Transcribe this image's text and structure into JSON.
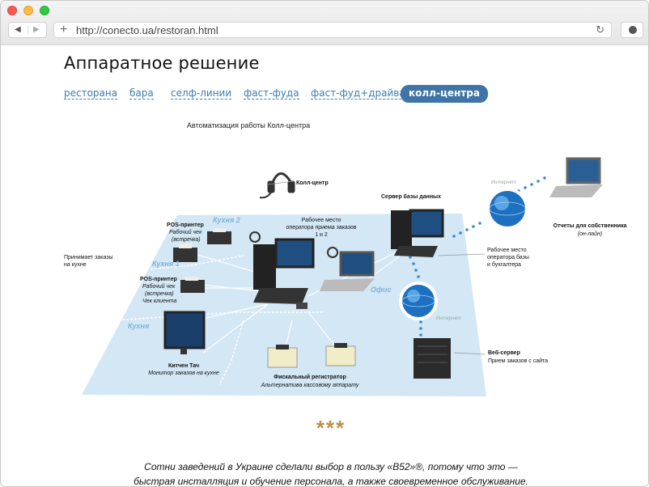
{
  "browser": {
    "url": "http://conecto.ua/restoran.html",
    "back": "◀",
    "forward": "▶",
    "new_tab": "+",
    "reload": "↻"
  },
  "page": {
    "title": "Аппаратное решение",
    "tabs": [
      {
        "label": "ресторана",
        "active": false
      },
      {
        "label": "бара",
        "active": false
      },
      {
        "label": "селф-линии",
        "active": false
      },
      {
        "label": "фаст-фуда",
        "active": false
      },
      {
        "label": "фаст-фуд+драйва",
        "active": false
      },
      {
        "label": "колл-центра",
        "active": true
      }
    ]
  },
  "diagram": {
    "title": "Автоматизация работы Колл-центра",
    "call_center": "Колл-центр",
    "pos_printer_1": "POS-принтер",
    "pos_printer_1_sub1": "Рабочий чек",
    "pos_printer_1_sub2": "(встречка)",
    "kitchen2": "Кухня 2",
    "kitchen1": "Кухня 1",
    "kitchen": "Кухня",
    "takes_orders_1": "Принимает заказы",
    "takes_orders_2": "на кухне",
    "pos_printer_2": "POS-принтер",
    "pos_printer_2_sub1": "Рабочий чек",
    "pos_printer_2_sub2": "(встречка)",
    "pos_printer_2_sub3": "Чек клиента",
    "operator_1": "Рабочее место",
    "operator_2": "оператора приема заказов",
    "operator_3": "1 и 2",
    "office": "Офис",
    "db_server": "Сервер базы данных",
    "internet_top": "Интернет",
    "internet_mid": "Интернет",
    "owner_reports": "Отчеты для собственника",
    "owner_reports_sub": "(он-лайн)",
    "accountant_1": "Рабочее место",
    "accountant_2": "оператора базы",
    "accountant_3": "и бухгалтера",
    "web_server": "Веб-сервер",
    "web_server_sub": "Прием заказов с сайта",
    "kitchen_touch": "Китчен Тач",
    "kitchen_touch_sub": "Монитор заказов на кухне",
    "fiscal": "Фискальный регистратор",
    "fiscal_sub": "Альтернатива кассовому аппарату"
  },
  "footer": {
    "stars": "***",
    "promo_line1": "Сотни заведений в Украине сделали выбор в пользу «В52»®, потому что это —",
    "promo_line2": "быстрая инсталляция и обучение персонала, а также своевременное обслуживание."
  },
  "colors": {
    "accent": "#3f74a6",
    "link": "#3b7bb0",
    "floor": "#d3e7f5",
    "stars": "#b8944a"
  }
}
